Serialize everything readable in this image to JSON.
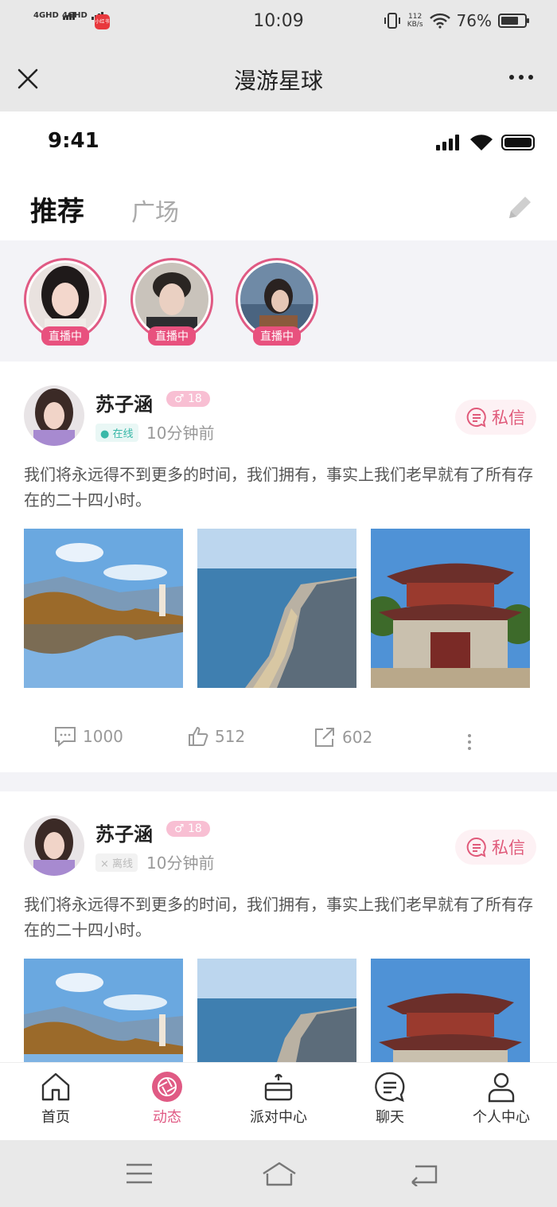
{
  "os_status": {
    "signal1": "4GHD",
    "signal2": "4GHD",
    "app_badge": "小红书",
    "time": "10:09",
    "speed_value": "112",
    "speed_unit": "KB/s",
    "battery": "76%",
    "battery_level": 0.76
  },
  "titlebar": {
    "title": "漫游星球"
  },
  "inner_status": {
    "time": "9:41"
  },
  "tabs": {
    "active": "推荐",
    "other": "广场"
  },
  "live_streams": [
    {
      "label": "直播中"
    },
    {
      "label": "直播中"
    },
    {
      "label": "直播中"
    }
  ],
  "posts": [
    {
      "name": "苏子涵",
      "level": "♂ 18",
      "status": "在线",
      "time_ago": "10分钟前",
      "dm_label": "私信",
      "text": "我们将永远得不到更多的时间，我们拥有，事实上我们老早就有了所有存在的二十四小时。",
      "comments": "1000",
      "likes": "512",
      "shares": "602"
    },
    {
      "name": "苏子涵",
      "level": "♂ 18",
      "status": "离线",
      "time_ago": "10分钟前",
      "dm_label": "私信",
      "text": "我们将永远得不到更多的时间，我们拥有，事实上我们老早就有了所有存在的二十四小时。"
    }
  ],
  "nav": {
    "home": "首页",
    "feed": "动态",
    "party": "派对中心",
    "chat": "聊天",
    "profile": "个人中心"
  },
  "colors": {
    "accent": "#e05a84",
    "online": "#3ab8a8"
  }
}
